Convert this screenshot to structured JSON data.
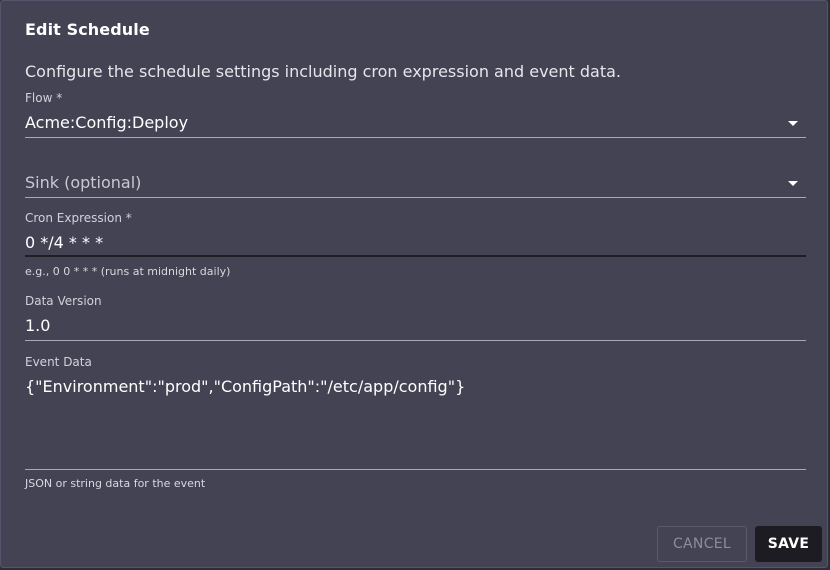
{
  "dialog": {
    "title": "Edit Schedule",
    "description": "Configure the schedule settings including cron expression and event data."
  },
  "fields": {
    "flow": {
      "label": "Flow *",
      "value": "Acme:Config:Deploy",
      "icon": "chevron-down-icon"
    },
    "sink": {
      "placeholder": "Sink (optional)",
      "icon": "chevron-down-icon"
    },
    "cron": {
      "label": "Cron Expression *",
      "value": "0 */4 * * *",
      "helper": "e.g., 0 0 * * * (runs at midnight daily)"
    },
    "data_version": {
      "label": "Data Version",
      "value": "1.0"
    },
    "event_data": {
      "label": "Event Data",
      "value": "{\"Environment\":\"prod\",\"ConfigPath\":\"/etc/app/config\"}",
      "helper": "JSON or string data for the event"
    }
  },
  "actions": {
    "cancel_label": "CANCEL",
    "save_label": "SAVE"
  },
  "colors": {
    "dialog_bg": "#434354",
    "text": "#ffffff",
    "save_bg": "#1c1c22"
  }
}
